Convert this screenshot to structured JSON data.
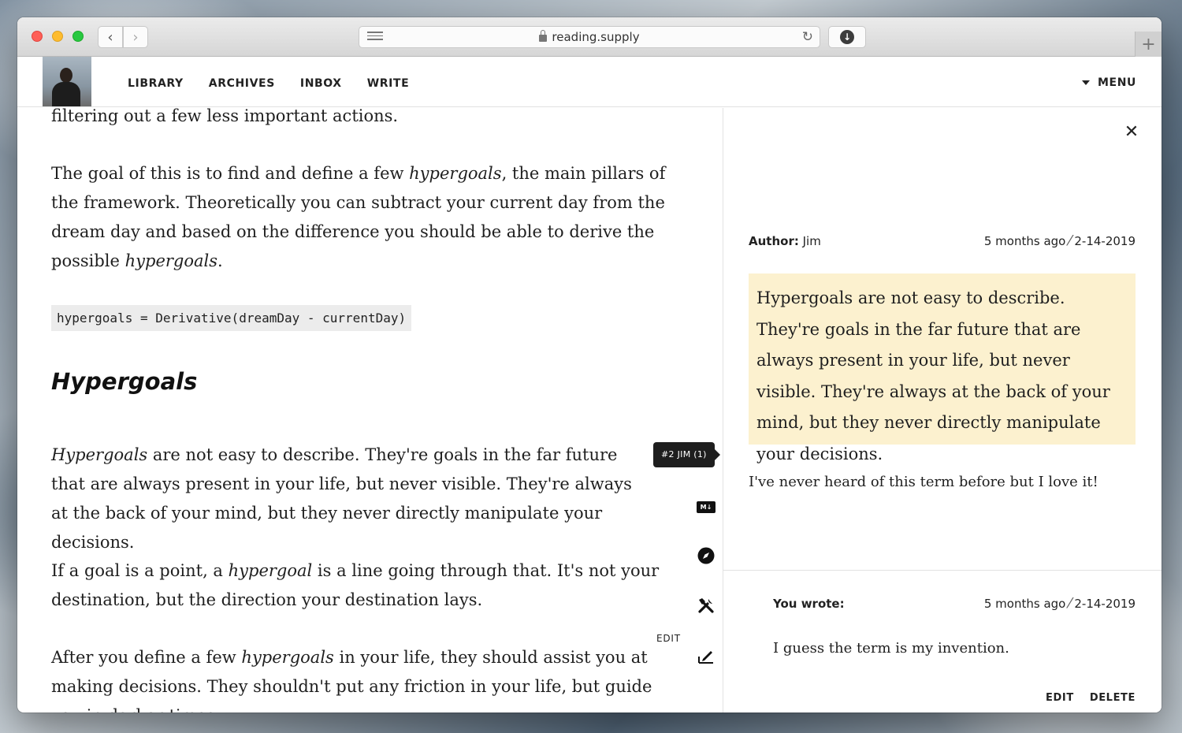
{
  "browser": {
    "url": "reading.supply",
    "back_icon": "chevron-left-icon",
    "forward_icon": "chevron-right-icon"
  },
  "nav": {
    "links": [
      "LIBRARY",
      "ARCHIVES",
      "INBOX",
      "WRITE"
    ],
    "menu_label": "MENU"
  },
  "article": {
    "p0": "filtering out a few less important actions.",
    "p1_a": "The goal of this is to find and define a few ",
    "p1_em": "hypergoals",
    "p1_b": ", the main pillars of the framework. Theoretically you can subtract your current day from the dream day and based on the difference you should be able to derive the possible ",
    "p1_em2": "hypergoals",
    "p1_c": ".",
    "code": "hypergoals = Derivative(dreamDay - currentDay)",
    "heading": "Hypergoals",
    "p2_em": "Hypergoals",
    "p2_b": " are not easy to describe. They're goals in the far future that are always present in your life, but never visible. They're always at the back of your mind, but they never directly manipulate your decisions.",
    "p3_a": "If a goal is a point, a ",
    "p3_em": "hypergoal",
    "p3_b": " is a line going through that. It's not your destination, but the direction your destination lays.",
    "p4_a": "After you define a few ",
    "p4_em": "hypergoals",
    "p4_b": " in your life, they should assist you at making decisions. They shouldn't put any friction in your life, but guide you in darker times."
  },
  "sidebar_tools": {
    "tooltip": "#2 JIM (1)",
    "markdown_icon_text": "M↓",
    "edit_label": "EDIT"
  },
  "panel": {
    "author_label": "Author:",
    "author_name": "Jim",
    "author_time": "5 months ago",
    "author_date": "2-14-2019",
    "highlight": "Hypergoals are not easy to describe. They're goals in the far future that are always present in your life, but never visible. They're always at the back of your mind, but they never directly manipulate your decisions.",
    "comment": "I've never heard of this term before but I love it!",
    "you_label": "You wrote:",
    "you_time": "5 months ago",
    "you_date": "2-14-2019",
    "reply": "I guess the term is my invention.",
    "edit": "EDIT",
    "delete": "DELETE"
  },
  "colors": {
    "highlight_bg": "#fcf1cf",
    "tooltip_bg": "#1e1e1e"
  }
}
